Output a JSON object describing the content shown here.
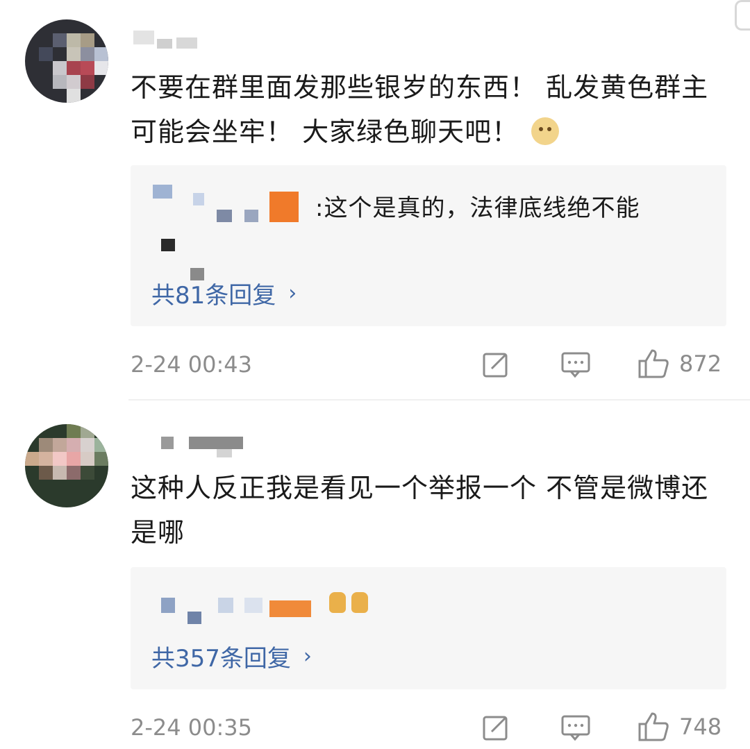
{
  "comments": [
    {
      "text": "不要在群里面发那些银岁的东西！ 乱发黄色群主可能会坐牢！ 大家绿色聊天吧！",
      "emoji": "doge-emoji",
      "reply": {
        "text": ":这个是真的，法律底线绝不能",
        "more": "共81条回复"
      },
      "time": "2-24 00:43",
      "likes": "872"
    },
    {
      "text": "这种人反正我是看见一个举报一个 不管是微博还是哪",
      "reply": {
        "emoji": "thumbs-up-emoji",
        "more": "共357条回复"
      },
      "time": "2-24 00:35",
      "likes": "748"
    }
  ],
  "icons": {
    "edit": "edit-icon",
    "comment": "comment-icon",
    "like": "thumbs-up-icon",
    "reply_more": "chevron-right-icon"
  },
  "colors": {
    "link": "#3f67a6",
    "meta": "#8c8c8c",
    "reply_bg": "#f6f6f6"
  }
}
